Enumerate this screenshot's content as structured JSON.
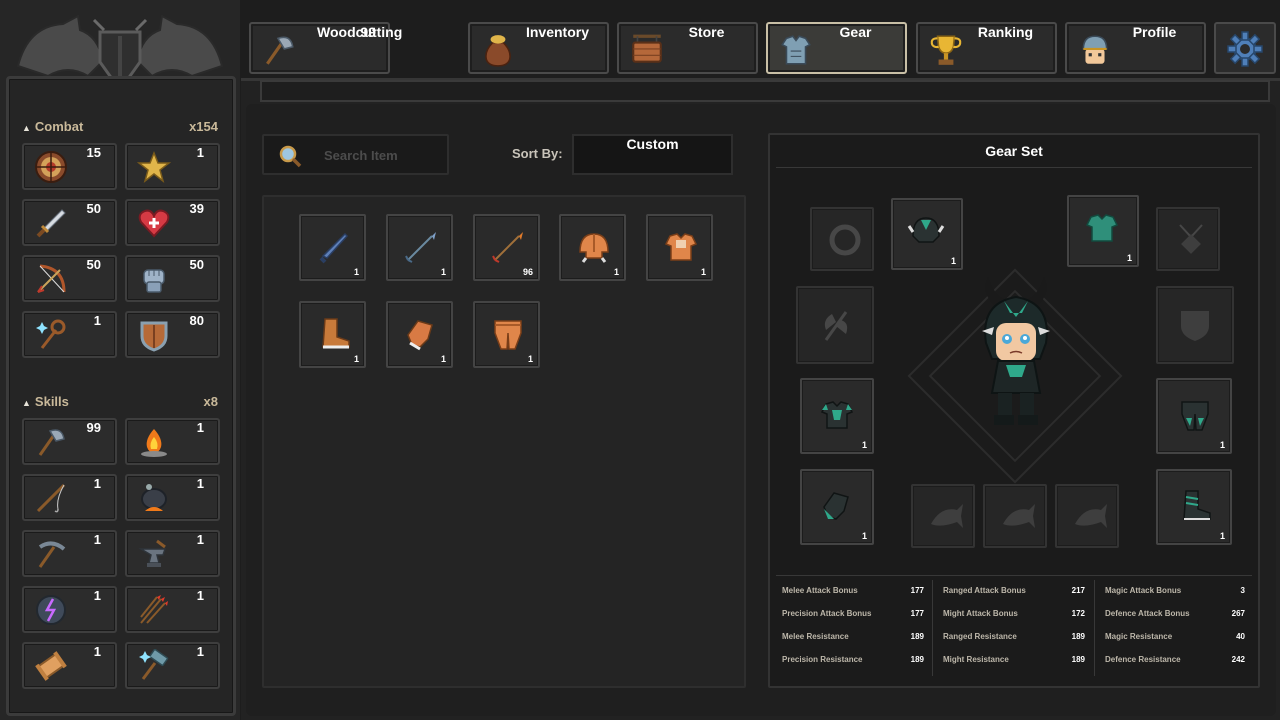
{
  "tabs": [
    {
      "id": "woodcutting",
      "label": "Woodcutting",
      "value": "99",
      "icon": "axe-icon",
      "active": false
    },
    {
      "id": "inventory",
      "label": "Inventory",
      "icon": "money-bag-icon",
      "active": false
    },
    {
      "id": "store",
      "label": "Store",
      "icon": "shop-sign-icon",
      "active": false
    },
    {
      "id": "gear",
      "label": "Gear",
      "icon": "armor-icon",
      "active": true
    },
    {
      "id": "ranking",
      "label": "Ranking",
      "icon": "trophy-icon",
      "active": false
    },
    {
      "id": "profile",
      "label": "Profile",
      "icon": "helmet-avatar-icon",
      "active": false
    }
  ],
  "settings": {
    "icon": "gear-icon"
  },
  "sidebar": {
    "combat": {
      "title": "Combat",
      "count": "x154",
      "items": [
        {
          "icon": "target-icon",
          "value": "15"
        },
        {
          "icon": "star-icon",
          "value": "1"
        },
        {
          "icon": "sword-icon",
          "value": "50"
        },
        {
          "icon": "heart-icon",
          "value": "39"
        },
        {
          "icon": "bow-icon",
          "value": "50"
        },
        {
          "icon": "fist-icon",
          "value": "50"
        },
        {
          "icon": "magic-staff-icon",
          "value": "1"
        },
        {
          "icon": "shield-icon",
          "value": "80"
        }
      ]
    },
    "skills": {
      "title": "Skills",
      "count": "x8",
      "items": [
        {
          "icon": "axe-icon",
          "value": "99"
        },
        {
          "icon": "campfire-icon",
          "value": "1"
        },
        {
          "icon": "fishing-rod-icon",
          "value": "1"
        },
        {
          "icon": "cauldron-icon",
          "value": "1"
        },
        {
          "icon": "pickaxe-icon",
          "value": "1"
        },
        {
          "icon": "anvil-icon",
          "value": "1"
        },
        {
          "icon": "rune-stone-icon",
          "value": "1"
        },
        {
          "icon": "arrows-icon",
          "value": "1"
        },
        {
          "icon": "thread-spool-icon",
          "value": "1"
        },
        {
          "icon": "hammer-icon",
          "value": "1"
        }
      ]
    }
  },
  "search": {
    "placeholder": "Search Item",
    "icon": "magnifier-icon"
  },
  "sort": {
    "label": "Sort By:",
    "value": "Custom"
  },
  "inventory_items": [
    {
      "icon": "sword-blade-icon",
      "qty": "1"
    },
    {
      "icon": "arrow-icon",
      "qty": "1"
    },
    {
      "icon": "fire-arrow-icon",
      "qty": "96"
    },
    {
      "icon": "leather-helmet-icon",
      "qty": "1"
    },
    {
      "icon": "leather-chestplate-icon",
      "qty": "1"
    },
    {
      "icon": "leather-boots-icon",
      "qty": "1"
    },
    {
      "icon": "leather-gloves-icon",
      "qty": "1"
    },
    {
      "icon": "leather-pants-icon",
      "qty": "1"
    }
  ],
  "gear": {
    "title": "Gear Set",
    "slots": {
      "ring": {
        "icon": "ring-icon",
        "qty": "",
        "equipped": false
      },
      "helmet": {
        "icon": "dark-helmet-icon",
        "qty": "1",
        "equipped": true
      },
      "cape": {
        "icon": "teal-cape-icon",
        "qty": "1",
        "equipped": true
      },
      "amulet": {
        "icon": "amulet-icon",
        "qty": "",
        "equipped": false
      },
      "weapon": {
        "icon": "battle-axe-icon",
        "qty": "",
        "equipped": false
      },
      "offhand": {
        "icon": "shield-icon",
        "qty": "",
        "equipped": false
      },
      "body": {
        "icon": "dark-chestplate-icon",
        "qty": "1",
        "equipped": true
      },
      "legs": {
        "icon": "dark-greaves-icon",
        "qty": "1",
        "equipped": true
      },
      "gloves": {
        "icon": "teal-gauntlet-icon",
        "qty": "1",
        "equipped": true
      },
      "tool1": {
        "icon": "fish-icon",
        "qty": "",
        "equipped": false
      },
      "tool2": {
        "icon": "fish-icon",
        "qty": "",
        "equipped": false
      },
      "tool3": {
        "icon": "fish-icon",
        "qty": "",
        "equipped": false
      },
      "boots": {
        "icon": "dark-boots-icon",
        "qty": "1",
        "equipped": true
      }
    },
    "stats": [
      [
        {
          "label": "Melee Attack Bonus",
          "value": "177"
        },
        {
          "label": "Precision Attack Bonus",
          "value": "177"
        },
        {
          "label": "Melee Resistance",
          "value": "189"
        },
        {
          "label": "Precision Resistance",
          "value": "189"
        }
      ],
      [
        {
          "label": "Ranged Attack Bonus",
          "value": "217"
        },
        {
          "label": "Might Attack Bonus",
          "value": "172"
        },
        {
          "label": "Ranged Resistance",
          "value": "189"
        },
        {
          "label": "Might Resistance",
          "value": "189"
        }
      ],
      [
        {
          "label": "Magic Attack Bonus",
          "value": "3"
        },
        {
          "label": "Defence Attack Bonus",
          "value": "267"
        },
        {
          "label": "Magic Resistance",
          "value": "40"
        },
        {
          "label": "Defence Resistance",
          "value": "242"
        }
      ]
    ]
  },
  "colors": {
    "accent": "#c8bfa6",
    "panel": "#2b2b2b",
    "border": "#444444",
    "teal": "#2f8f7a"
  }
}
